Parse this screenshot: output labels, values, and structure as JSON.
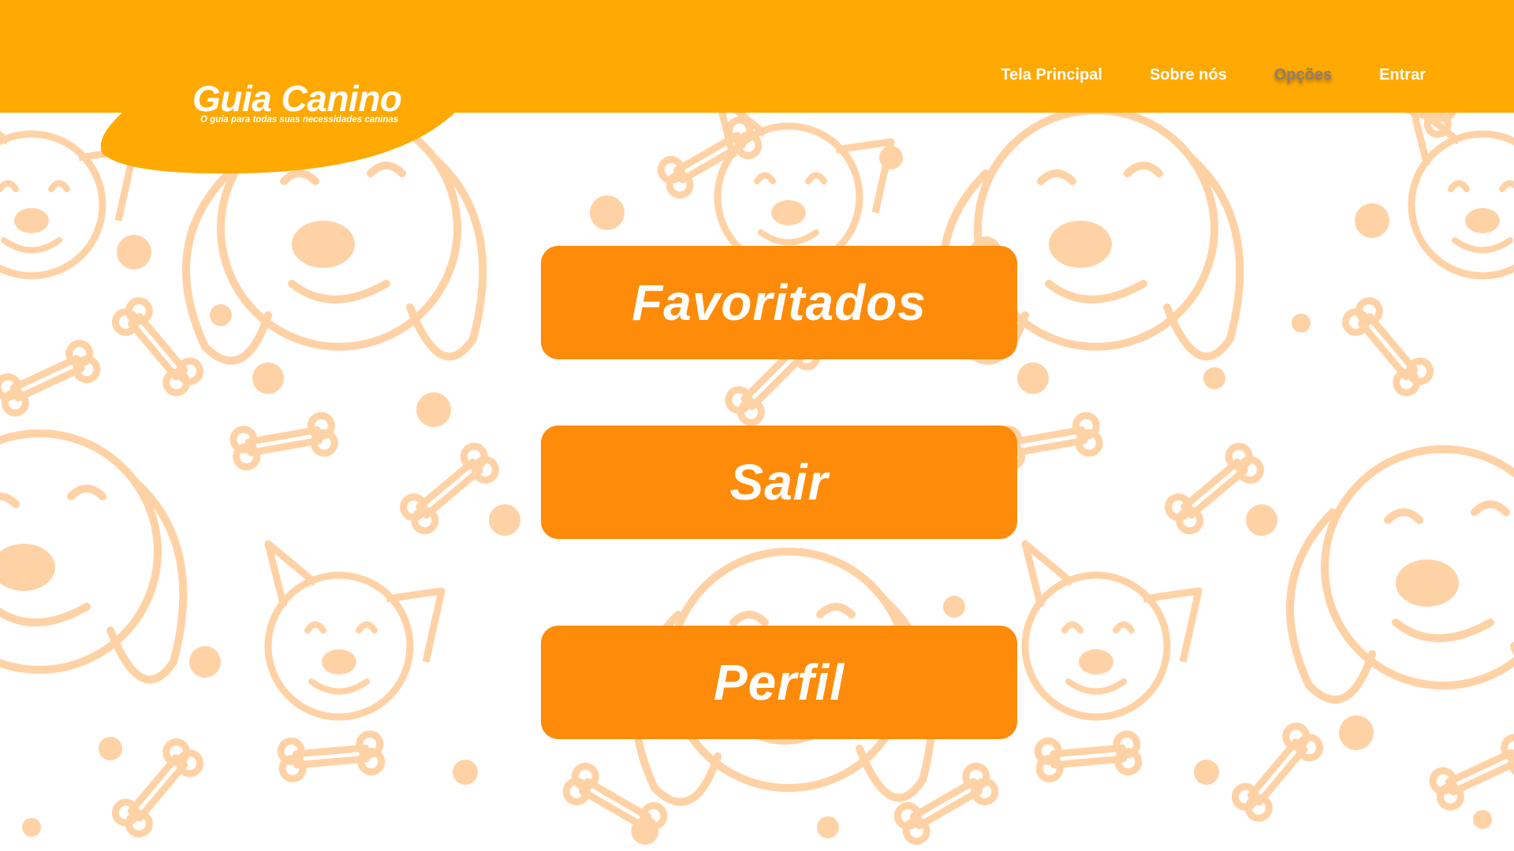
{
  "brand": {
    "title": "Guia Canino",
    "tagline": "O guia para todas suas necessidades caninas"
  },
  "nav": {
    "items": [
      {
        "label": "Tela Principal",
        "active": false
      },
      {
        "label": "Sobre nós",
        "active": false
      },
      {
        "label": "Opções",
        "active": true
      },
      {
        "label": "Entrar",
        "active": false
      }
    ]
  },
  "options": {
    "favorites_label": "Favoritados",
    "logout_label": "Sair",
    "profile_label": "Perfil"
  },
  "colors": {
    "header": "#ffa902",
    "button": "#fe8b09",
    "pattern": "#ffd2a6",
    "active_nav": "#8f7d6e",
    "text": "#ffffff"
  },
  "icons": [
    "dog-face-icon",
    "bone-icon",
    "paw-dot-icon"
  ]
}
